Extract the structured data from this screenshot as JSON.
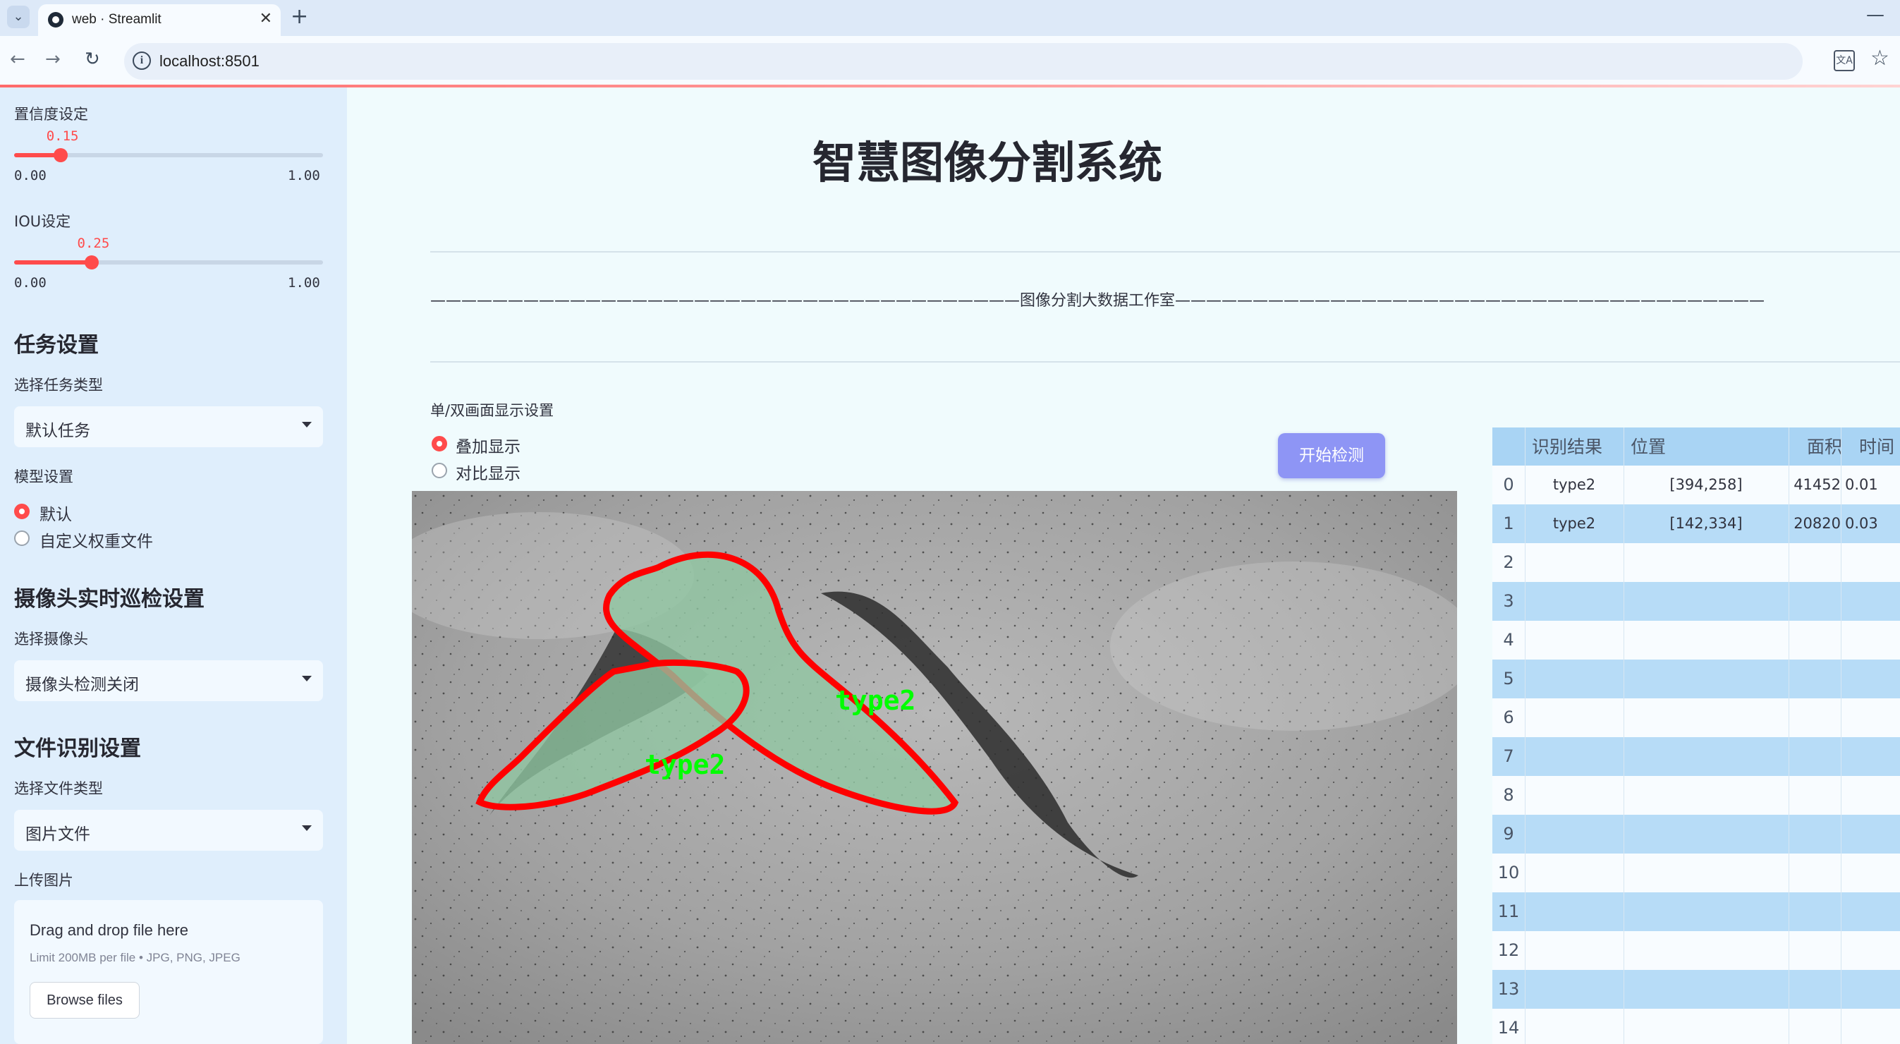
{
  "browser": {
    "tab_title": "web · Streamlit",
    "new_tab": "+",
    "close": "✕",
    "url": "localhost:8501"
  },
  "sidebar": {
    "conf_label": "置信度设定",
    "conf_value": "0.15",
    "conf_fraction": 0.15,
    "conf_min": "0.00",
    "conf_max": "1.00",
    "iou_label": "IOU设定",
    "iou_value": "0.25",
    "iou_fraction": 0.25,
    "iou_min": "0.00",
    "iou_max": "1.00",
    "task_heading": "任务设置",
    "task_type_label": "选择任务类型",
    "task_type_value": "默认任务",
    "model_label": "模型设置",
    "model_options": [
      "默认",
      "自定义权重文件"
    ],
    "model_selected": 0,
    "camera_heading": "摄像头实时巡检设置",
    "camera_label": "选择摄像头",
    "camera_value": "摄像头检测关闭",
    "file_heading": "文件识别设置",
    "file_type_label": "选择文件类型",
    "file_type_value": "图片文件",
    "upload_label": "上传图片",
    "upload_title": "Drag and drop file here",
    "upload_limit": "Limit 200MB per file • JPG, PNG, JPEG",
    "browse_label": "Browse files"
  },
  "main": {
    "title": "智慧图像分割系统",
    "divider_text": "——————————————————————————————————————图像分割大数据工作室——————————————————————————————————————",
    "display_mode_label": "单/双画面显示设置",
    "display_options": [
      "叠加显示",
      "对比显示"
    ],
    "display_selected": 0,
    "start_button": "开始检测",
    "image_labels": [
      "type2",
      "type2"
    ]
  },
  "table": {
    "headers": [
      "识别结果",
      "位置",
      "面积",
      "时间"
    ],
    "rows": [
      {
        "idx": "0",
        "result": "type2",
        "pos": "[394,258]",
        "area": "41452",
        "time": "0.01"
      },
      {
        "idx": "1",
        "result": "type2",
        "pos": "[142,334]",
        "area": "20820",
        "time": "0.03"
      },
      {
        "idx": "2",
        "result": "",
        "pos": "",
        "area": "",
        "time": ""
      },
      {
        "idx": "3",
        "result": "",
        "pos": "",
        "area": "",
        "time": ""
      },
      {
        "idx": "4",
        "result": "",
        "pos": "",
        "area": "",
        "time": ""
      },
      {
        "idx": "5",
        "result": "",
        "pos": "",
        "area": "",
        "time": ""
      },
      {
        "idx": "6",
        "result": "",
        "pos": "",
        "area": "",
        "time": ""
      },
      {
        "idx": "7",
        "result": "",
        "pos": "",
        "area": "",
        "time": ""
      },
      {
        "idx": "8",
        "result": "",
        "pos": "",
        "area": "",
        "time": ""
      },
      {
        "idx": "9",
        "result": "",
        "pos": "",
        "area": "",
        "time": ""
      },
      {
        "idx": "10",
        "result": "",
        "pos": "",
        "area": "",
        "time": ""
      },
      {
        "idx": "11",
        "result": "",
        "pos": "",
        "area": "",
        "time": ""
      },
      {
        "idx": "12",
        "result": "",
        "pos": "",
        "area": "",
        "time": ""
      },
      {
        "idx": "13",
        "result": "",
        "pos": "",
        "area": "",
        "time": ""
      },
      {
        "idx": "14",
        "result": "",
        "pos": "",
        "area": "",
        "time": ""
      }
    ]
  },
  "colors": {
    "accent": "#ff4b4b",
    "button": "#8e95f5",
    "table_header": "#a9d4f4",
    "table_alt": "#b7dcf7",
    "mask_fill": "#8fc7a2",
    "mask_outline": "#ff0000",
    "label_text": "#00ff00"
  }
}
